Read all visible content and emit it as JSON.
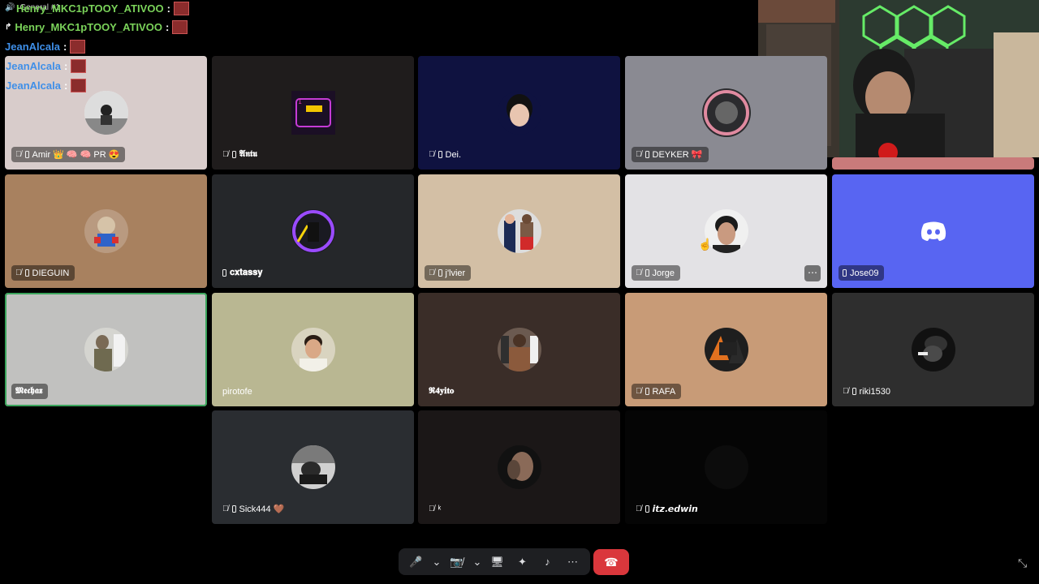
{
  "header": {
    "channel_label": "General #1"
  },
  "chat_messages": [
    {
      "user": "Henry_MKC1pTOOY_ATIVOO",
      "suffix": ":",
      "color": "#7bd35a"
    },
    {
      "user": "Henry_MKC1pTOOY_ATIVOO",
      "suffix": ":",
      "color": "#7bd35a"
    },
    {
      "user": "JeanAlcala",
      "suffix": ":",
      "color": "#3f8fe8"
    },
    {
      "user": "JeanAlcala",
      "suffix": ":",
      "color": "#3f8fe8"
    },
    {
      "user": "JeanAlcala",
      "suffix": ":",
      "color": "#3f8fe8"
    }
  ],
  "participants": [
    {
      "name": "Amir 👑 🧠 🧠 PR 😍",
      "bg": "#d8cccb",
      "muted": true,
      "mobile": true
    },
    {
      "name": "𝕬𝖓𝖙𝖚",
      "bg": "#1f1c1c",
      "muted": true,
      "mobile": true
    },
    {
      "name": "Dei.",
      "bg": "#0f1240",
      "muted": true,
      "mobile": true
    },
    {
      "name": "DEYKER 🎀",
      "bg": "#8a8a92",
      "muted": true,
      "mobile": true
    },
    {
      "name": "",
      "bg": "#c97a7a",
      "muted": false,
      "mobile": false
    },
    {
      "name": "DIEGUIN",
      "bg": "#a8815f",
      "muted": true,
      "mobile": true
    },
    {
      "name": "𝐜𝐱𝐭𝐚𝐬𝐬𝐲",
      "bg": "#25272a",
      "muted": false,
      "mobile": true
    },
    {
      "name": "j'lvier",
      "bg": "#d3bfa5",
      "muted": true,
      "mobile": true
    },
    {
      "name": "Jorge",
      "bg": "#e3e2e5",
      "muted": true,
      "mobile": true
    },
    {
      "name": "Jose09",
      "bg": "#5865f2",
      "muted": false,
      "mobile": true
    },
    {
      "name": "𝕸𝖊𝖈𝖍𝖆𝖝",
      "bg": "#c1c1bf",
      "muted": false,
      "mobile": false
    },
    {
      "name": "pirotofe",
      "bg": "#b9b792",
      "muted": false,
      "mobile": false
    },
    {
      "name": "𝕽𝟒𝐲𝐢𝐭𝐨",
      "bg": "#3a2d28",
      "muted": false,
      "mobile": false
    },
    {
      "name": "RAFA",
      "bg": "#c89b77",
      "muted": true,
      "mobile": true
    },
    {
      "name": "riki1530",
      "bg": "#2e2e2e",
      "muted": true,
      "mobile": true
    },
    {
      "name": "Sick444 🤎",
      "bg": "#2a2d31",
      "muted": true,
      "mobile": true
    },
    {
      "name": "ᵏ",
      "bg": "#1b1717",
      "muted": true,
      "mobile": false
    },
    {
      "name": "𝙞𝙩𝙯.𝙚𝙙𝙬𝙞𝙣",
      "bg": "#050505",
      "muted": true,
      "mobile": true
    }
  ],
  "controls": {
    "mic_label": "microphone",
    "camera_label": "camera",
    "more_label": "⋯"
  },
  "colors": {
    "accent_green": "#3ba55c",
    "hangup_red": "#da373c",
    "bar_bg": "#1e1f22"
  }
}
